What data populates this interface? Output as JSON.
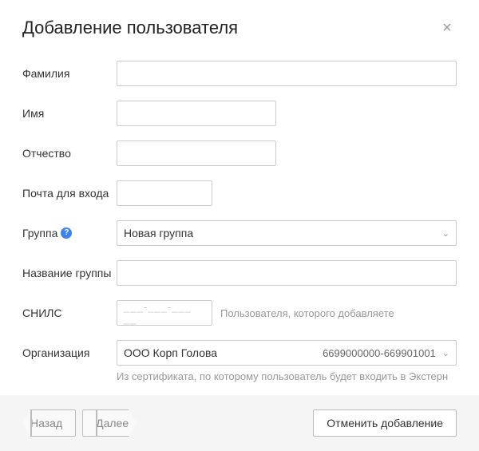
{
  "title": "Добавление пользователя",
  "fields": {
    "lastname": {
      "label": "Фамилия",
      "value": ""
    },
    "firstname": {
      "label": "Имя",
      "value": ""
    },
    "patronymic": {
      "label": "Отчество",
      "value": ""
    },
    "email": {
      "label": "Почта для входа",
      "value": ""
    },
    "group": {
      "label": "Группа",
      "selected": "Новая группа"
    },
    "groupname": {
      "label": "Название группы",
      "value": ""
    },
    "snils": {
      "label": "СНИЛС",
      "placeholder": "___-___-___ __",
      "hint": "Пользователя, которого добавляете"
    },
    "org": {
      "label": "Организация",
      "selected": "ООО Корп Голова",
      "code": "6699000000-669901001",
      "hint": "Из сертификата, по которому пользователь будет входить в Экстерн"
    }
  },
  "buttons": {
    "back": "Назад",
    "next": "Далее",
    "cancel": "Отменить добавление"
  }
}
